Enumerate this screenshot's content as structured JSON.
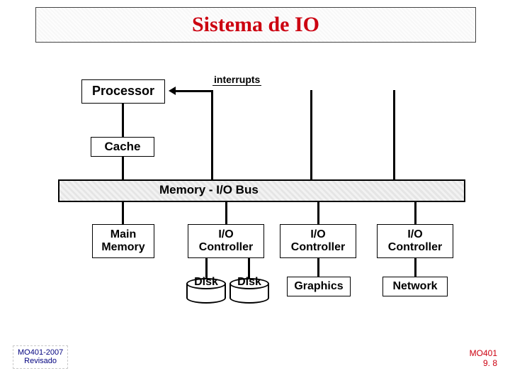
{
  "title": "Sistema de IO",
  "blocks": {
    "processor": "Processor",
    "cache": "Cache",
    "interrupts": "interrupts",
    "bus": "Memory - I/O Bus",
    "main_memory": "Main\nMemory",
    "io_controller": "I/O\nController",
    "disk": "Disk",
    "graphics": "Graphics",
    "network": "Network"
  },
  "footer": {
    "left_line1": "MO401-2007",
    "left_line2": "Revisado",
    "right_line1": "MO401",
    "right_line2": "9. 8"
  }
}
